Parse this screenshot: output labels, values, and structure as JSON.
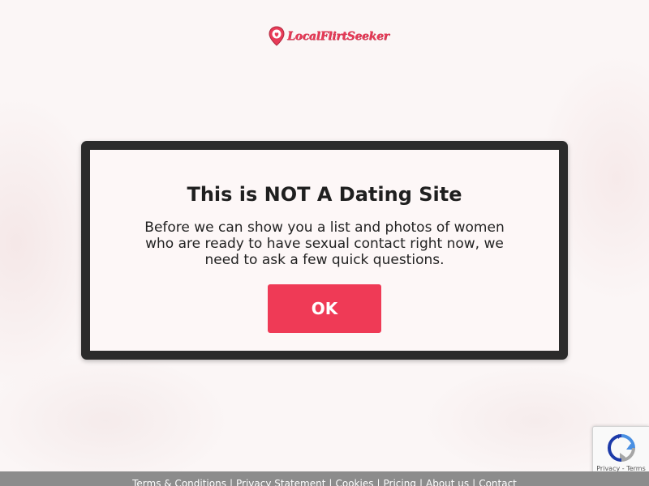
{
  "brand": {
    "name": "LocalFlirtSeeker",
    "accent": "#e83a57"
  },
  "modal": {
    "title": "This is NOT A Dating Site",
    "text": "Before we can show you a list and photos of women who are ready to have sexual contact right now, we need to ask a few quick questions.",
    "button_label": "OK",
    "button_color": "#ef3a56"
  },
  "recaptcha": {
    "links": "Privacy - Terms"
  },
  "footer": {
    "links": [
      "Terms & Conditions",
      "Privacy Statement",
      "Cookies",
      "Pricing",
      "About us",
      "Contact"
    ],
    "separator": "|",
    "bg_color": "#8c8c8c"
  }
}
